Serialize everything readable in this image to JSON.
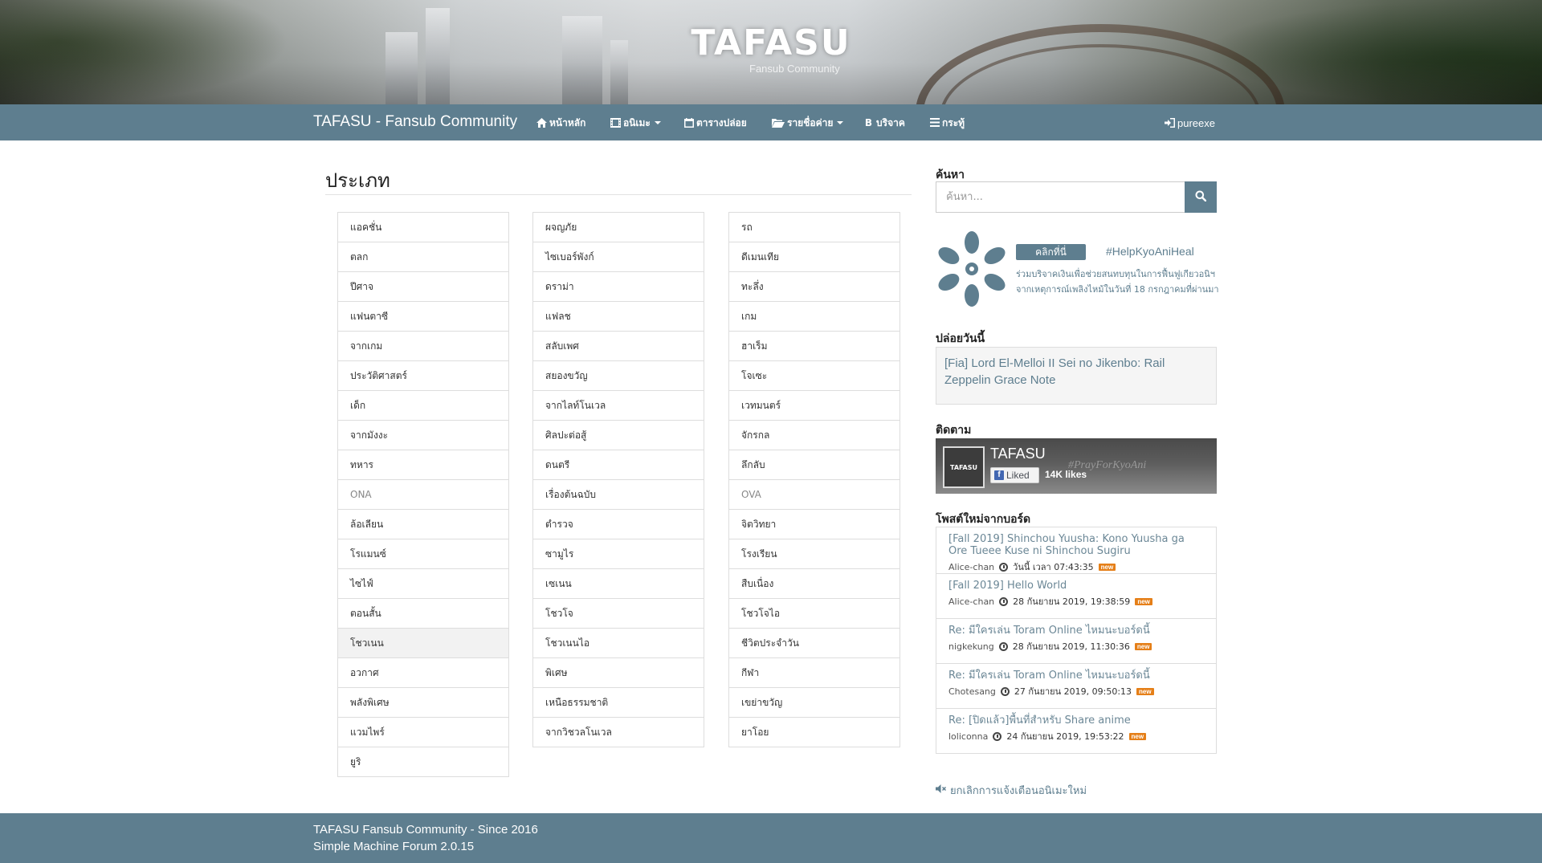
{
  "banner": {
    "title": "TAFASU",
    "subtitle": "Fansub Community"
  },
  "navbar": {
    "brand": "TAFASU - Fansub Community",
    "items": [
      {
        "label": "หน้าหลัก",
        "icon": "home-icon"
      },
      {
        "label": "อนิเมะ",
        "icon": "film-icon"
      },
      {
        "label": "ตารางปล่อย",
        "icon": "calendar-icon"
      },
      {
        "label": "รายชื่อค่าย",
        "icon": "folder-open-icon"
      },
      {
        "label": "บริจาค",
        "icon": "bitcoin-icon"
      },
      {
        "label": "กระทู้",
        "icon": "list-icon"
      }
    ],
    "user": "pureexe"
  },
  "main": {
    "title": "ประเภท",
    "columns": [
      [
        "แอคชั่น",
        "ตลก",
        "ปีศาจ",
        "แฟนตาซี",
        "จากเกม",
        "ประวัติศาสตร์",
        "เด็ก",
        "จากมังงะ",
        "ทหาร",
        "ONA",
        "ล้อเลียน",
        "โรแมนซ์",
        "ไซไฟ์",
        "ตอนสั้น",
        "โชวเนน",
        "อวกาศ",
        "พลังพิเศษ",
        "แวมไพร์",
        "ยูริ"
      ],
      [
        "ผจญภัย",
        "ไซเบอร์พังก์",
        "ดราม่า",
        "แฟลช",
        "สลับเพศ",
        "สยองขวัญ",
        "จากไลท์โนเวล",
        "ศิลปะต่อสู้",
        "ดนตรี",
        "เรื่องต้นฉบับ",
        "ตำรวจ",
        "ซามูไร",
        "เซเนน",
        "โชวโจ",
        "โชวเนนไอ",
        "พิเศษ",
        "เหนือธรรมชาติ",
        "จากวิชวลโนเวล"
      ],
      [
        "รถ",
        "ดีเมนเทีย",
        "ทะลึ่ง",
        "เกม",
        "ฮาเร็ม",
        "โจเซะ",
        "เวทมนตร์",
        "จักรกล",
        "ลึกลับ",
        "OVA",
        "จิตวิทยา",
        "โรงเรียน",
        "สืบเนื่อง",
        "โชวโจไอ",
        "ชีวิตประจำวัน",
        "กีฬา",
        "เขย่าขวัญ",
        "ยาโอย"
      ]
    ]
  },
  "sidebar": {
    "search": {
      "heading": "ค้นหา",
      "placeholder": "ค้นหา..."
    },
    "kyoani": {
      "button": "คลิกที่นี่",
      "hashtag": "#HelpKyoAniHeal",
      "line1": "ร่วมบริจาคเงินเพื่อช่วยสนทบทุนในการฟื้นฟูเกียวอนิฯ",
      "line2": "จากเหตุการณ์เพลิงไหม้ในวันที่ 18 กรกฎาคมที่ผ่านมา"
    },
    "release": {
      "heading": "ปล่อยวันนี้",
      "item": "[Fia] Lord El-Melloi II Sei no Jikenbo: Rail Zeppelin Grace Note"
    },
    "follow": {
      "heading": "ติดตาม",
      "page_name": "TAFASU",
      "logo_text": "TAFASU",
      "hashtag": "#PrayForKyoAni",
      "liked": "Liked",
      "likes": "14K likes"
    },
    "posts": {
      "heading": "โพสต์ใหม่จากบอร์ด",
      "badge": "new",
      "items": [
        {
          "title": "[Fall 2019] Shinchou Yuusha: Kono Yuusha ga Ore Tueee Kuse ni Shinchou Sugiru",
          "author": "Alice-chan",
          "time": "วันนี้ เวลา 07:43:35"
        },
        {
          "title": "[Fall 2019] Hello World",
          "author": "Alice-chan",
          "time": "28 กันยายน 2019, 19:38:59"
        },
        {
          "title": "Re: มีใครเล่น Toram Online ไหมนะบอร์ดนี้",
          "author": "nigkekung",
          "time": "28 กันยายน 2019, 11:30:36"
        },
        {
          "title": "Re: มีใครเล่น Toram Online ไหมนะบอร์ดนี้",
          "author": "Chotesang",
          "time": "27 กันยายน 2019, 09:50:13"
        },
        {
          "title": "Re: [ปิดแล้ว]พื้นที่สำหรับ Share anime",
          "author": "loliconna",
          "time": "24 กันยายน 2019, 19:53:22"
        }
      ]
    },
    "mute": "ยกเลิกการแจ้งเตือนอนิเมะใหม่"
  },
  "footer": {
    "line1": "TAFASU Fansub Community - Since 2016",
    "line2": "Simple Machine Forum 2.0.15"
  },
  "colors": {
    "primary": "#5e7e8f",
    "badge": "#e57f18",
    "link": "#6b8796"
  }
}
